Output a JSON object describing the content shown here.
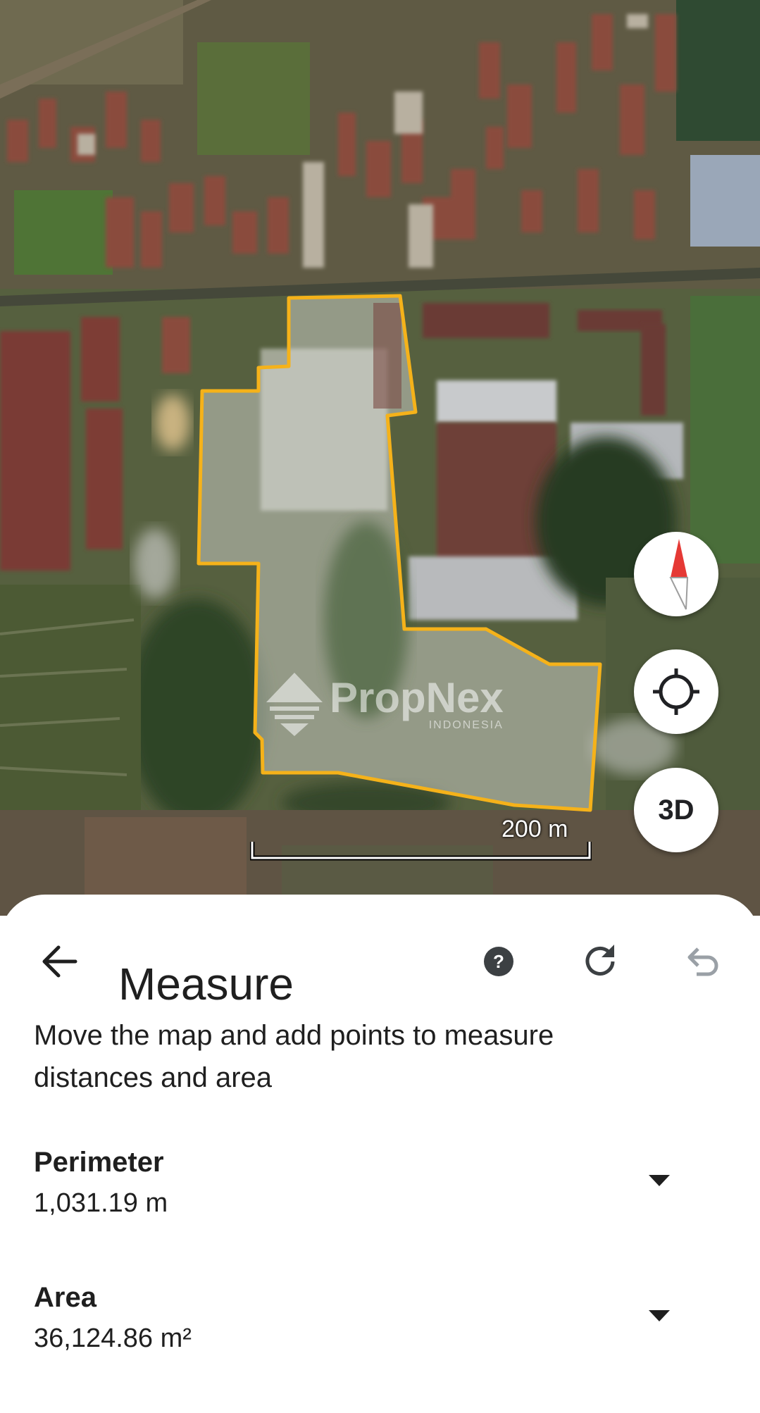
{
  "map": {
    "watermark": {
      "brand": "PropNex",
      "sub": "INDONESIA"
    },
    "scale_label": "200 m",
    "boundary_color": "#f5b21a",
    "controls": {
      "compass_icon": "compass-icon",
      "location_icon": "my-location-icon",
      "view_3d_label": "3D"
    }
  },
  "measure": {
    "title": "Measure",
    "back_icon": "back-arrow-icon",
    "help_icon": "help-icon",
    "refresh_icon": "refresh-icon",
    "undo_icon": "undo-icon",
    "instructions": "Move the map and add points to measure distances and area",
    "perimeter": {
      "label": "Perimeter",
      "value": "1,031.19 m"
    },
    "area": {
      "label": "Area",
      "value": "36,124.86 m²"
    }
  }
}
